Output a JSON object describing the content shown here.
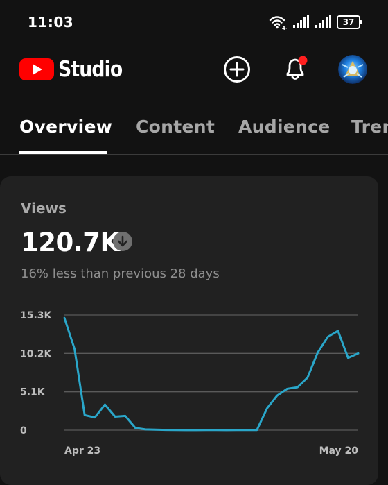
{
  "status_bar": {
    "time": "11:03",
    "battery": "37"
  },
  "app": {
    "logo_text": "Studio"
  },
  "tabs": [
    {
      "label": "Overview",
      "active": true
    },
    {
      "label": "Content",
      "active": false
    },
    {
      "label": "Audience",
      "active": false
    },
    {
      "label": "Tren",
      "active": false
    }
  ],
  "views_card": {
    "title": "Views",
    "value": "120.7K",
    "trend": "down",
    "comparison": "16% less than previous 28 days"
  },
  "colors": {
    "line": "#2aa6c9",
    "brand": "#ff0000",
    "notification": "#ff1f1f"
  },
  "chart_data": {
    "type": "line",
    "y_tick_labels": [
      "15.3K",
      "10.2K",
      "5.1K",
      "0"
    ],
    "y_tick_values": [
      15300,
      10200,
      5100,
      0
    ],
    "ylim": [
      0,
      15300
    ],
    "x_tick_labels": [
      "Apr 23",
      "May 20"
    ],
    "grid": true,
    "series": [
      {
        "values": [
          14900,
          10800,
          2000,
          1700,
          3400,
          1800,
          1900,
          300,
          100,
          60,
          40,
          20,
          10,
          10,
          20,
          20,
          10,
          20,
          20,
          20,
          2900,
          4600,
          5500,
          5700,
          7000,
          10300,
          12400,
          13200,
          9600,
          10200
        ]
      }
    ]
  }
}
